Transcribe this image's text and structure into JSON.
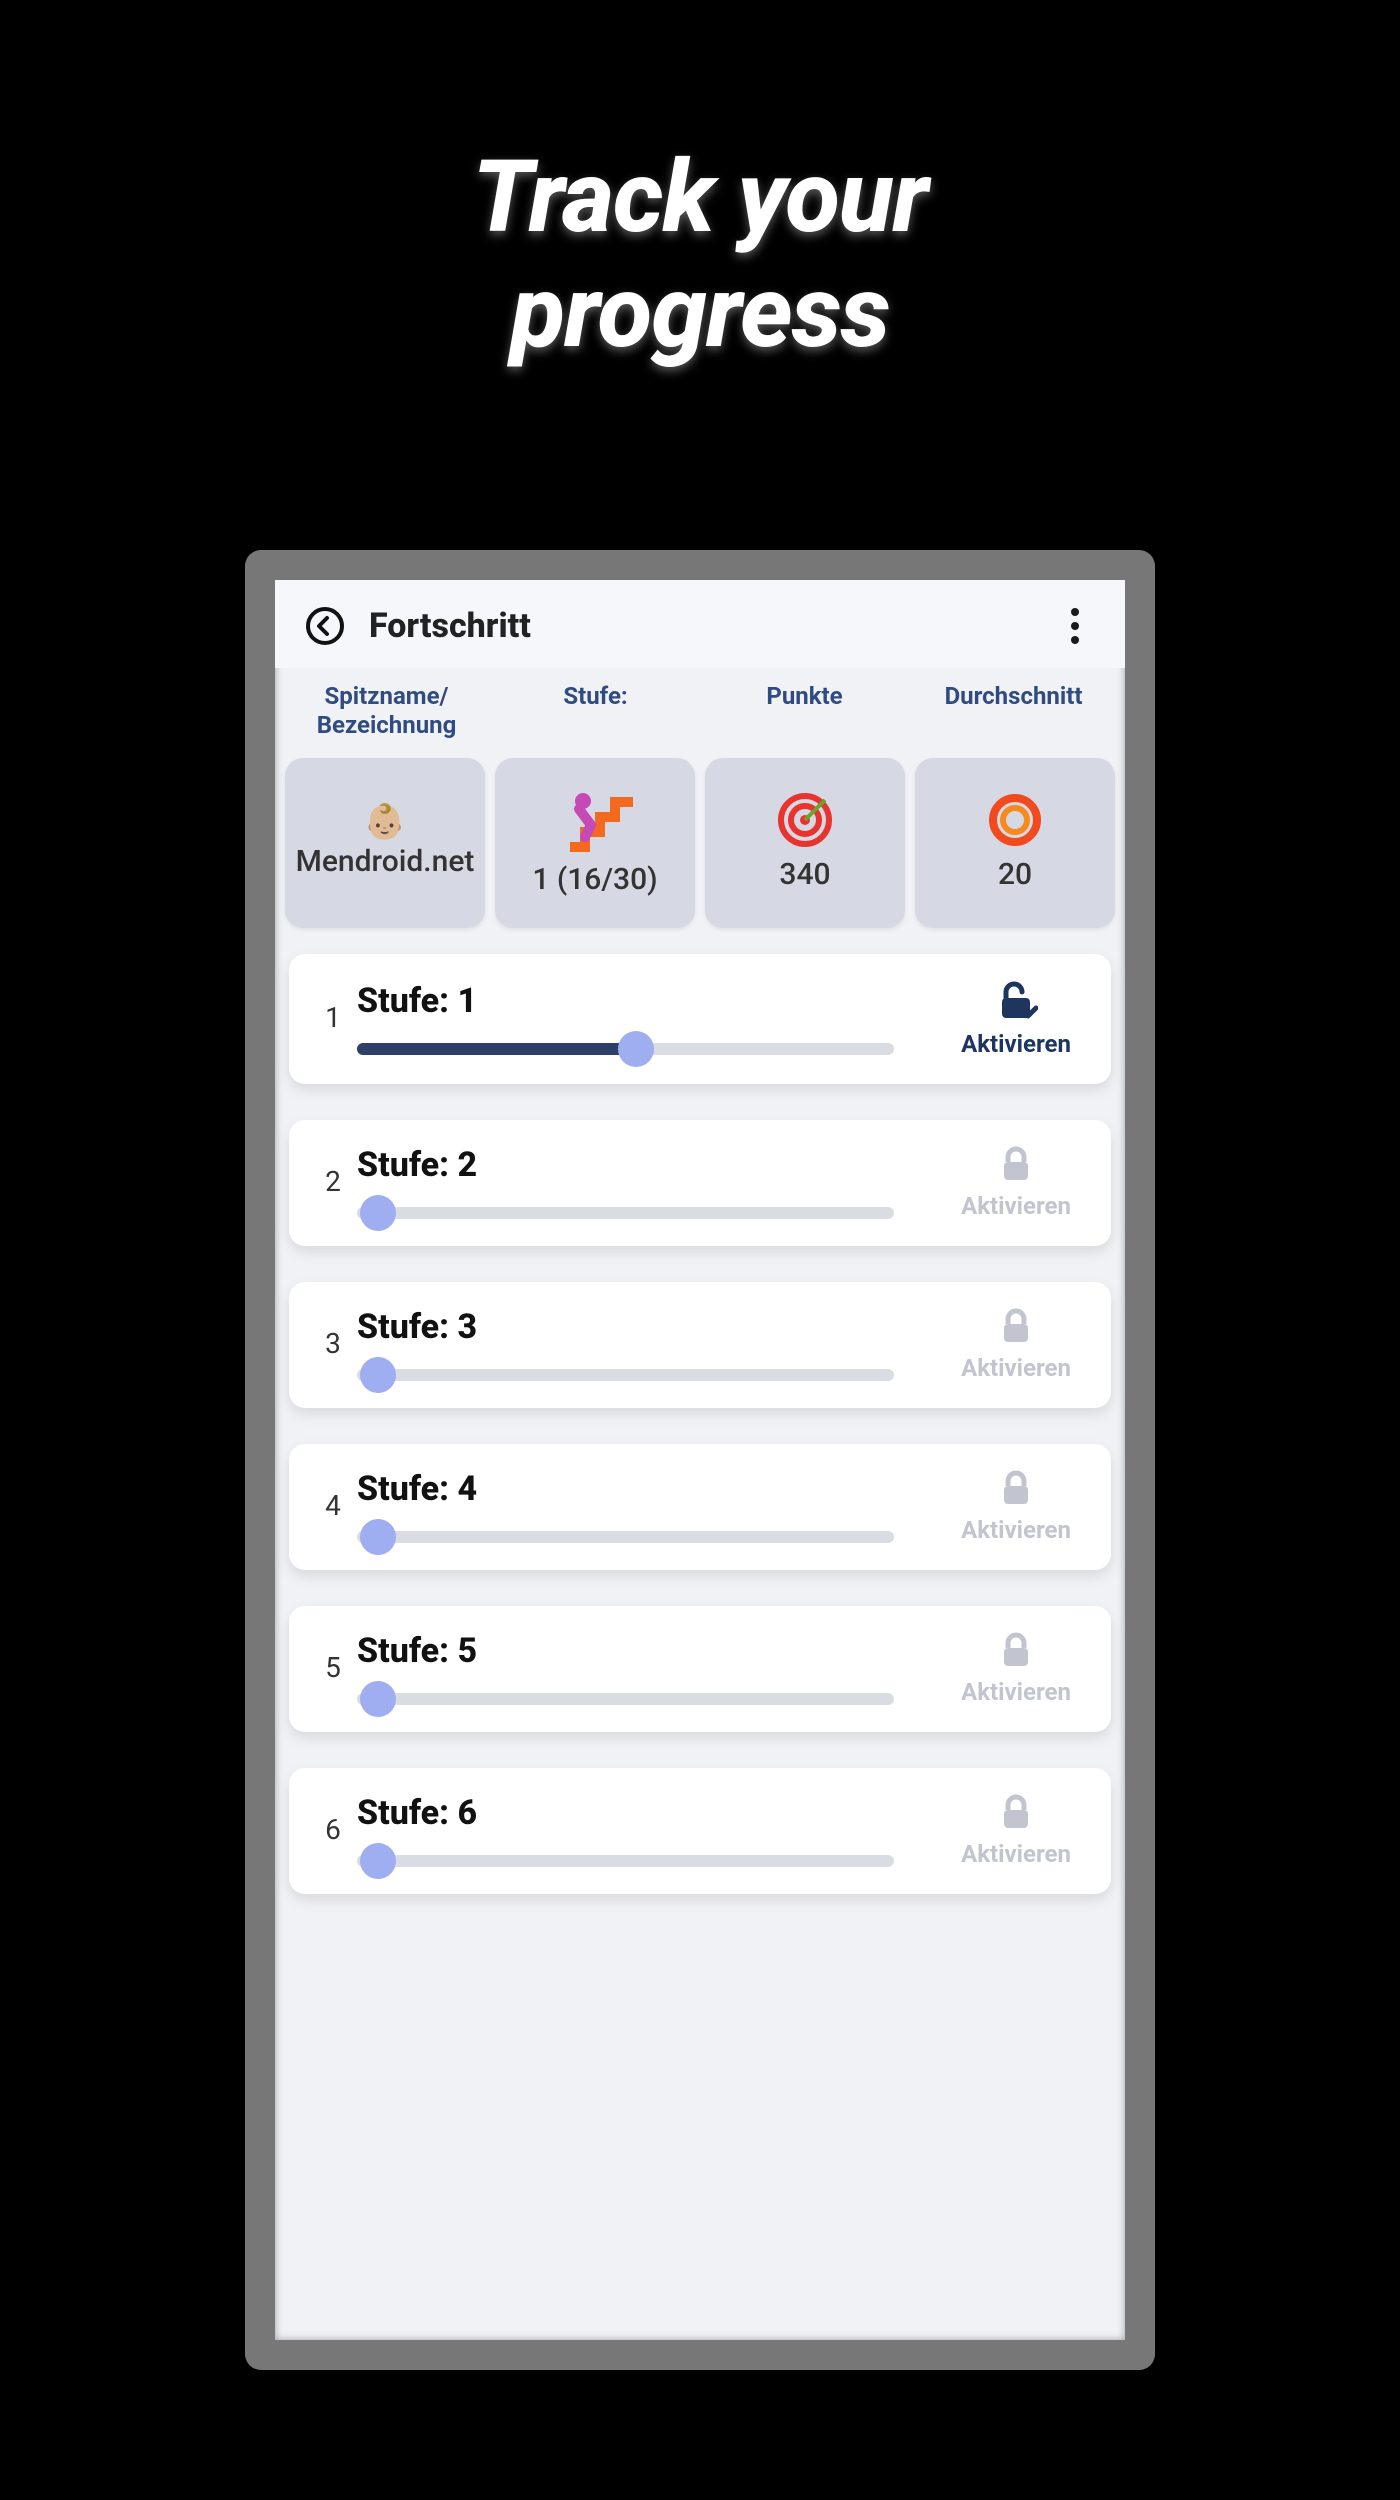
{
  "hero": {
    "line1": "Track your",
    "line2": "progress"
  },
  "header": {
    "title": "Fortschritt"
  },
  "columns": {
    "nickname": "Spitzname/\nBezeichnung",
    "level": "Stufe:",
    "points": "Punkte",
    "average": "Durchschnitt"
  },
  "stats": {
    "nickname_value": "Mendroid.net",
    "level_value": "1 (16/30)",
    "points_value": "340",
    "average_value": "20"
  },
  "levels": [
    {
      "index": "1",
      "title": "Stufe: 1",
      "progress": 52,
      "enabled": true,
      "action_label": "Aktivieren"
    },
    {
      "index": "2",
      "title": "Stufe: 2",
      "progress": 0,
      "enabled": false,
      "action_label": "Aktivieren"
    },
    {
      "index": "3",
      "title": "Stufe: 3",
      "progress": 0,
      "enabled": false,
      "action_label": "Aktivieren"
    },
    {
      "index": "4",
      "title": "Stufe: 4",
      "progress": 0,
      "enabled": false,
      "action_label": "Aktivieren"
    },
    {
      "index": "5",
      "title": "Stufe: 5",
      "progress": 0,
      "enabled": false,
      "action_label": "Aktivieren"
    },
    {
      "index": "6",
      "title": "Stufe: 6",
      "progress": 0,
      "enabled": false,
      "action_label": "Aktivieren"
    }
  ],
  "icons": {
    "back": "back-arrow-circle",
    "menu": "vertical-dots",
    "avatar": "face-emoji",
    "stairs": "stairs-person",
    "target": "bullseye",
    "ring": "circular-ring",
    "unlock": "unlock-check",
    "lock": "lock"
  }
}
